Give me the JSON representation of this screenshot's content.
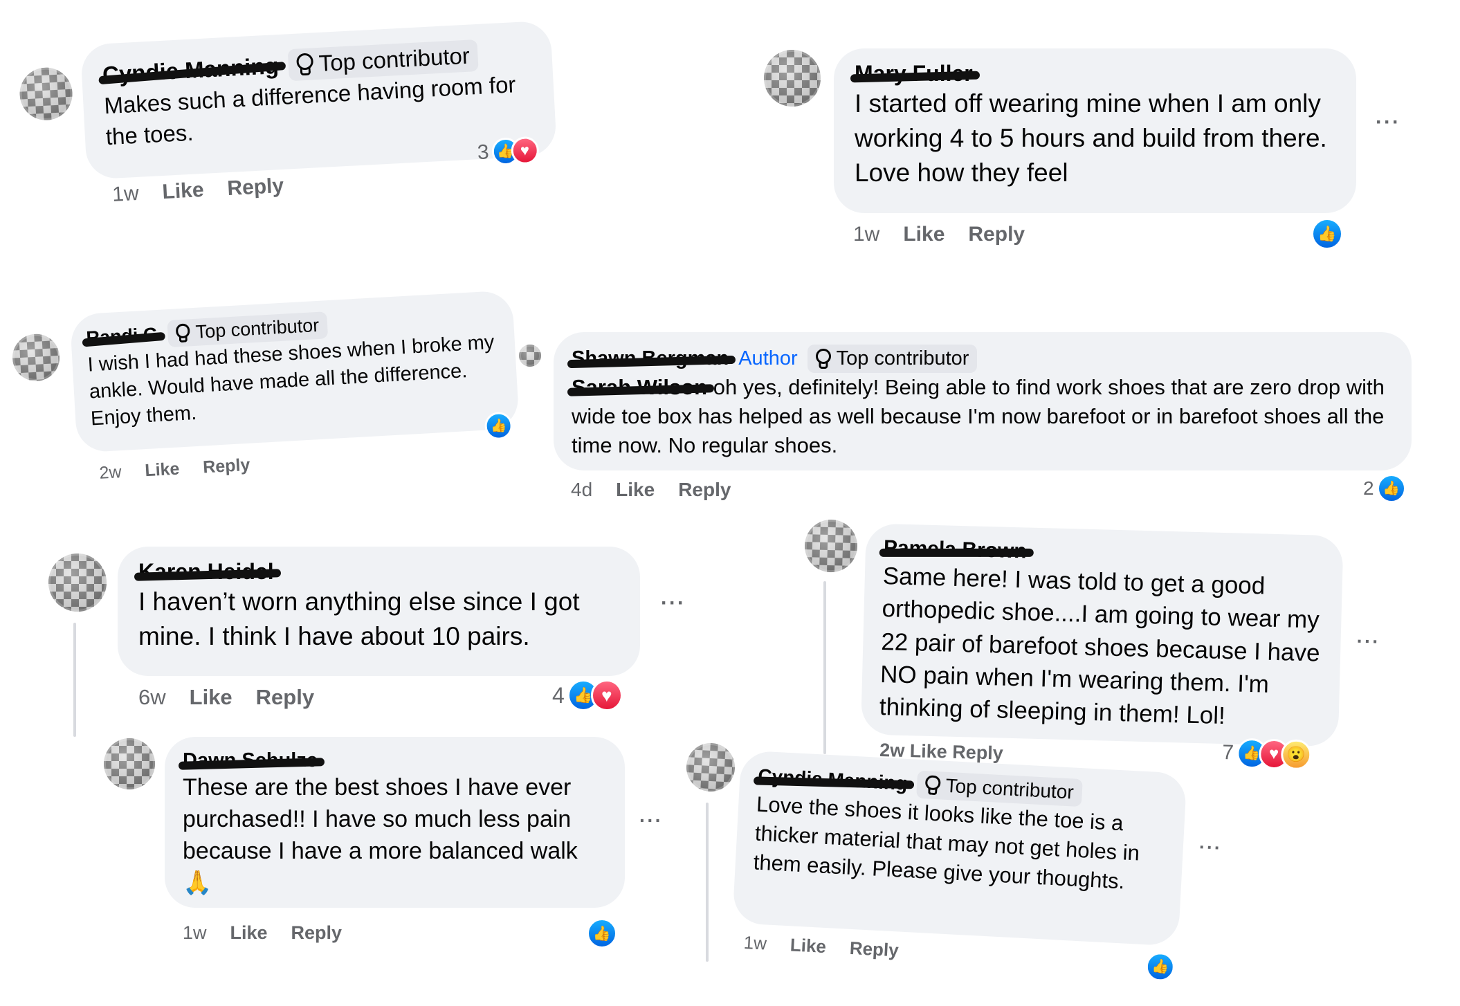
{
  "comments": [
    {
      "name": "Cyndie Manning",
      "badge": "Top contributor",
      "text": "Makes such a difference having room for the toes.",
      "time": "1w",
      "like": "Like",
      "reply": "Reply",
      "reaction_count": "3",
      "reactions": [
        "like-icon",
        "love-icon"
      ]
    },
    {
      "name": "Mary Fuller",
      "text": "I started off wearing mine when I am only working 4 to 5 hours and build from there. Love how they feel",
      "time": "1w",
      "like": "Like",
      "reply": "Reply",
      "reactions": [
        "like-icon"
      ],
      "more": "···"
    },
    {
      "name": "Randi G",
      "badge": "Top contributor",
      "text": "I wish I had had these shoes when I broke my ankle. Would have made all the difference. Enjoy them.",
      "time": "2w",
      "like": "Like",
      "reply": "Reply",
      "reactions": [
        "like-icon"
      ]
    },
    {
      "name": "Shawn Bergman",
      "author": "Author",
      "badge": "Top contributor",
      "mention": "Sarah Wilson",
      "text": "oh yes, definitely! Being able to find work shoes that are zero drop with wide toe box has helped as well because I'm now barefoot or in barefoot shoes all the time now. No regular shoes.",
      "time": "4d",
      "like": "Like",
      "reply": "Reply",
      "reaction_count": "2",
      "reactions": [
        "like-icon"
      ]
    },
    {
      "name": "Karen Heidel",
      "text": "I haven’t worn anything else since I got mine. I think I have about 10 pairs.",
      "time": "6w",
      "like": "Like",
      "reply": "Reply",
      "reaction_count": "4",
      "reactions": [
        "like-icon",
        "love-icon"
      ],
      "more": "···"
    },
    {
      "name": "Dawn Schulze",
      "text": "These are the best shoes I have ever purchased!! I have so much less pain because I have a more balanced walk",
      "emoji": "🙏",
      "time": "1w",
      "like": "Like",
      "reply": "Reply",
      "reactions": [
        "like-icon"
      ],
      "more": "···"
    },
    {
      "name": "Pamela Brown",
      "text": "Same here! I was told to get a good orthopedic shoe....I am going to wear my 22 pair of barefoot shoes because I have NO pain when I'm wearing them. I'm thinking of sleeping in them! Lol!",
      "partial_meta": "2w   Like   Reply",
      "reaction_count": "7",
      "reactions": [
        "like-icon",
        "love-icon",
        "wow-icon"
      ],
      "more": "···"
    },
    {
      "name": "Cyndie Manning",
      "badge": "Top contributor",
      "text": "Love the shoes it looks like the toe is a thicker material that may not get holes in them easily. Please give your thoughts.",
      "time": "1w",
      "like": "Like",
      "reply": "Reply",
      "reactions": [
        "like-icon"
      ],
      "more": "···"
    }
  ],
  "icons": {
    "like": "👍",
    "love": "♥",
    "wow": "😮",
    "badge": "top-contributor-icon"
  },
  "colors": {
    "bubble": "#f0f2f5",
    "meta": "#65676b",
    "author": "#0866ff",
    "like": "#0866ff",
    "love": "#f33e58"
  }
}
